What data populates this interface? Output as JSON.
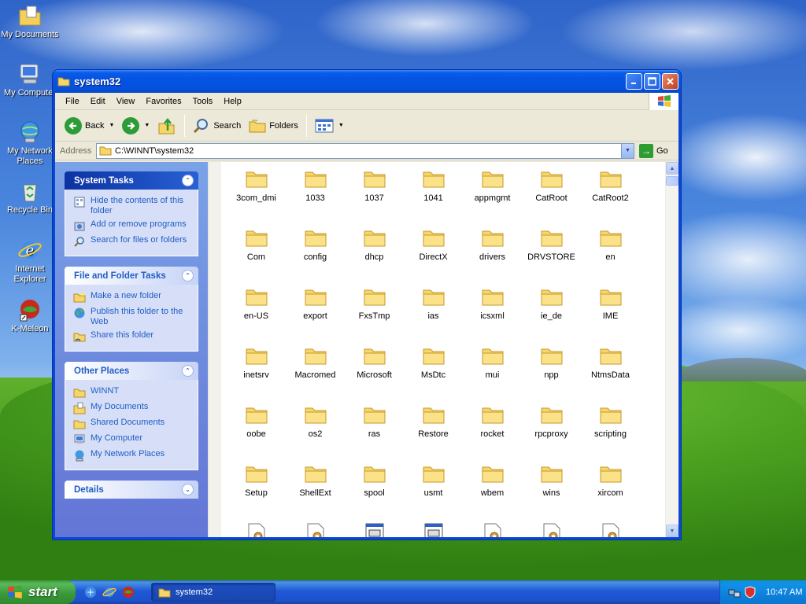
{
  "desktop": {
    "icons": [
      {
        "label": "My Documents"
      },
      {
        "label": "My Computer"
      },
      {
        "label": "My Network Places"
      },
      {
        "label": "Recycle Bin"
      },
      {
        "label": "Internet Explorer"
      },
      {
        "label": "K-Meleon"
      }
    ]
  },
  "window": {
    "title": "system32",
    "menu": [
      "File",
      "Edit",
      "View",
      "Favorites",
      "Tools",
      "Help"
    ],
    "toolbar": {
      "back_label": "Back",
      "search_label": "Search",
      "folders_label": "Folders"
    },
    "address": {
      "label": "Address",
      "value": "C:\\WINNT\\system32",
      "go_label": "Go"
    }
  },
  "taskpane": {
    "system_tasks": {
      "title": "System Tasks",
      "items": [
        {
          "label": "Hide the contents of this folder",
          "icon": "hide-contents-icon"
        },
        {
          "label": "Add or remove programs",
          "icon": "add-remove-programs-icon"
        },
        {
          "label": "Search for files or folders",
          "icon": "search-icon"
        }
      ]
    },
    "file_folder_tasks": {
      "title": "File and Folder Tasks",
      "items": [
        {
          "label": "Make a new folder",
          "icon": "new-folder-icon"
        },
        {
          "label": "Publish this folder to the Web",
          "icon": "globe-icon"
        },
        {
          "label": "Share this folder",
          "icon": "share-folder-icon"
        }
      ]
    },
    "other_places": {
      "title": "Other Places",
      "items": [
        {
          "label": "WINNT",
          "icon": "folder-icon"
        },
        {
          "label": "My Documents",
          "icon": "my-documents-icon"
        },
        {
          "label": "Shared Documents",
          "icon": "folder-icon"
        },
        {
          "label": "My Computer",
          "icon": "computer-icon"
        },
        {
          "label": "My Network Places",
          "icon": "network-icon"
        }
      ]
    },
    "details": {
      "title": "Details"
    }
  },
  "files": [
    "3com_dmi",
    "1033",
    "1037",
    "1041",
    "appmgmt",
    "CatRoot",
    "CatRoot2",
    "Com",
    "config",
    "dhcp",
    "DirectX",
    "drivers",
    "DRVSTORE",
    "en",
    "en-US",
    "export",
    "FxsTmp",
    "ias",
    "icsxml",
    "ie_de",
    "IME",
    "inetsrv",
    "Macromed",
    "Microsoft",
    "MsDtc",
    "mui",
    "npp",
    "NtmsData",
    "oobe",
    "os2",
    "ras",
    "Restore",
    "rocket",
    "rpcproxy",
    "scripting",
    "Setup",
    "ShellExt",
    "spool",
    "usmt",
    "wbem",
    "wins",
    "xircom"
  ],
  "partial_files": [
    {
      "icon": "settings-file-icon"
    },
    {
      "icon": "settings-file-icon"
    },
    {
      "icon": "executable-icon"
    },
    {
      "icon": "executable-icon"
    },
    {
      "icon": "settings-file-icon"
    },
    {
      "icon": "settings-file-icon"
    },
    {
      "icon": "settings-file-icon"
    }
  ],
  "taskbar": {
    "start_label": "start",
    "task_label": "system32",
    "clock": "10:47 AM"
  },
  "colors": {
    "xp_blue": "#0a47d5",
    "link_blue": "#215dc6",
    "folder_yellow": "#f6d56b"
  }
}
